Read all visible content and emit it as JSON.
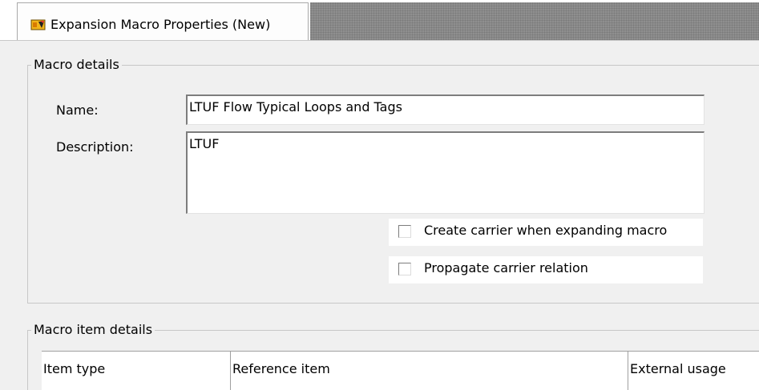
{
  "tab": {
    "label": "Expansion Macro Properties (New)",
    "icon": "macro-icon"
  },
  "macro_details": {
    "legend": "Macro details",
    "name_label": "Name:",
    "name_value": "LTUF Flow Typical Loops and Tags",
    "description_label": "Description:",
    "description_value": "LTUF",
    "create_carrier_label": "Create carrier when expanding macro",
    "create_carrier_checked": false,
    "propagate_carrier_label": "Propagate carrier relation",
    "propagate_carrier_checked": false
  },
  "macro_item_details": {
    "legend": "Macro item details",
    "columns": [
      "Item type",
      "Reference item",
      "External usage"
    ]
  }
}
